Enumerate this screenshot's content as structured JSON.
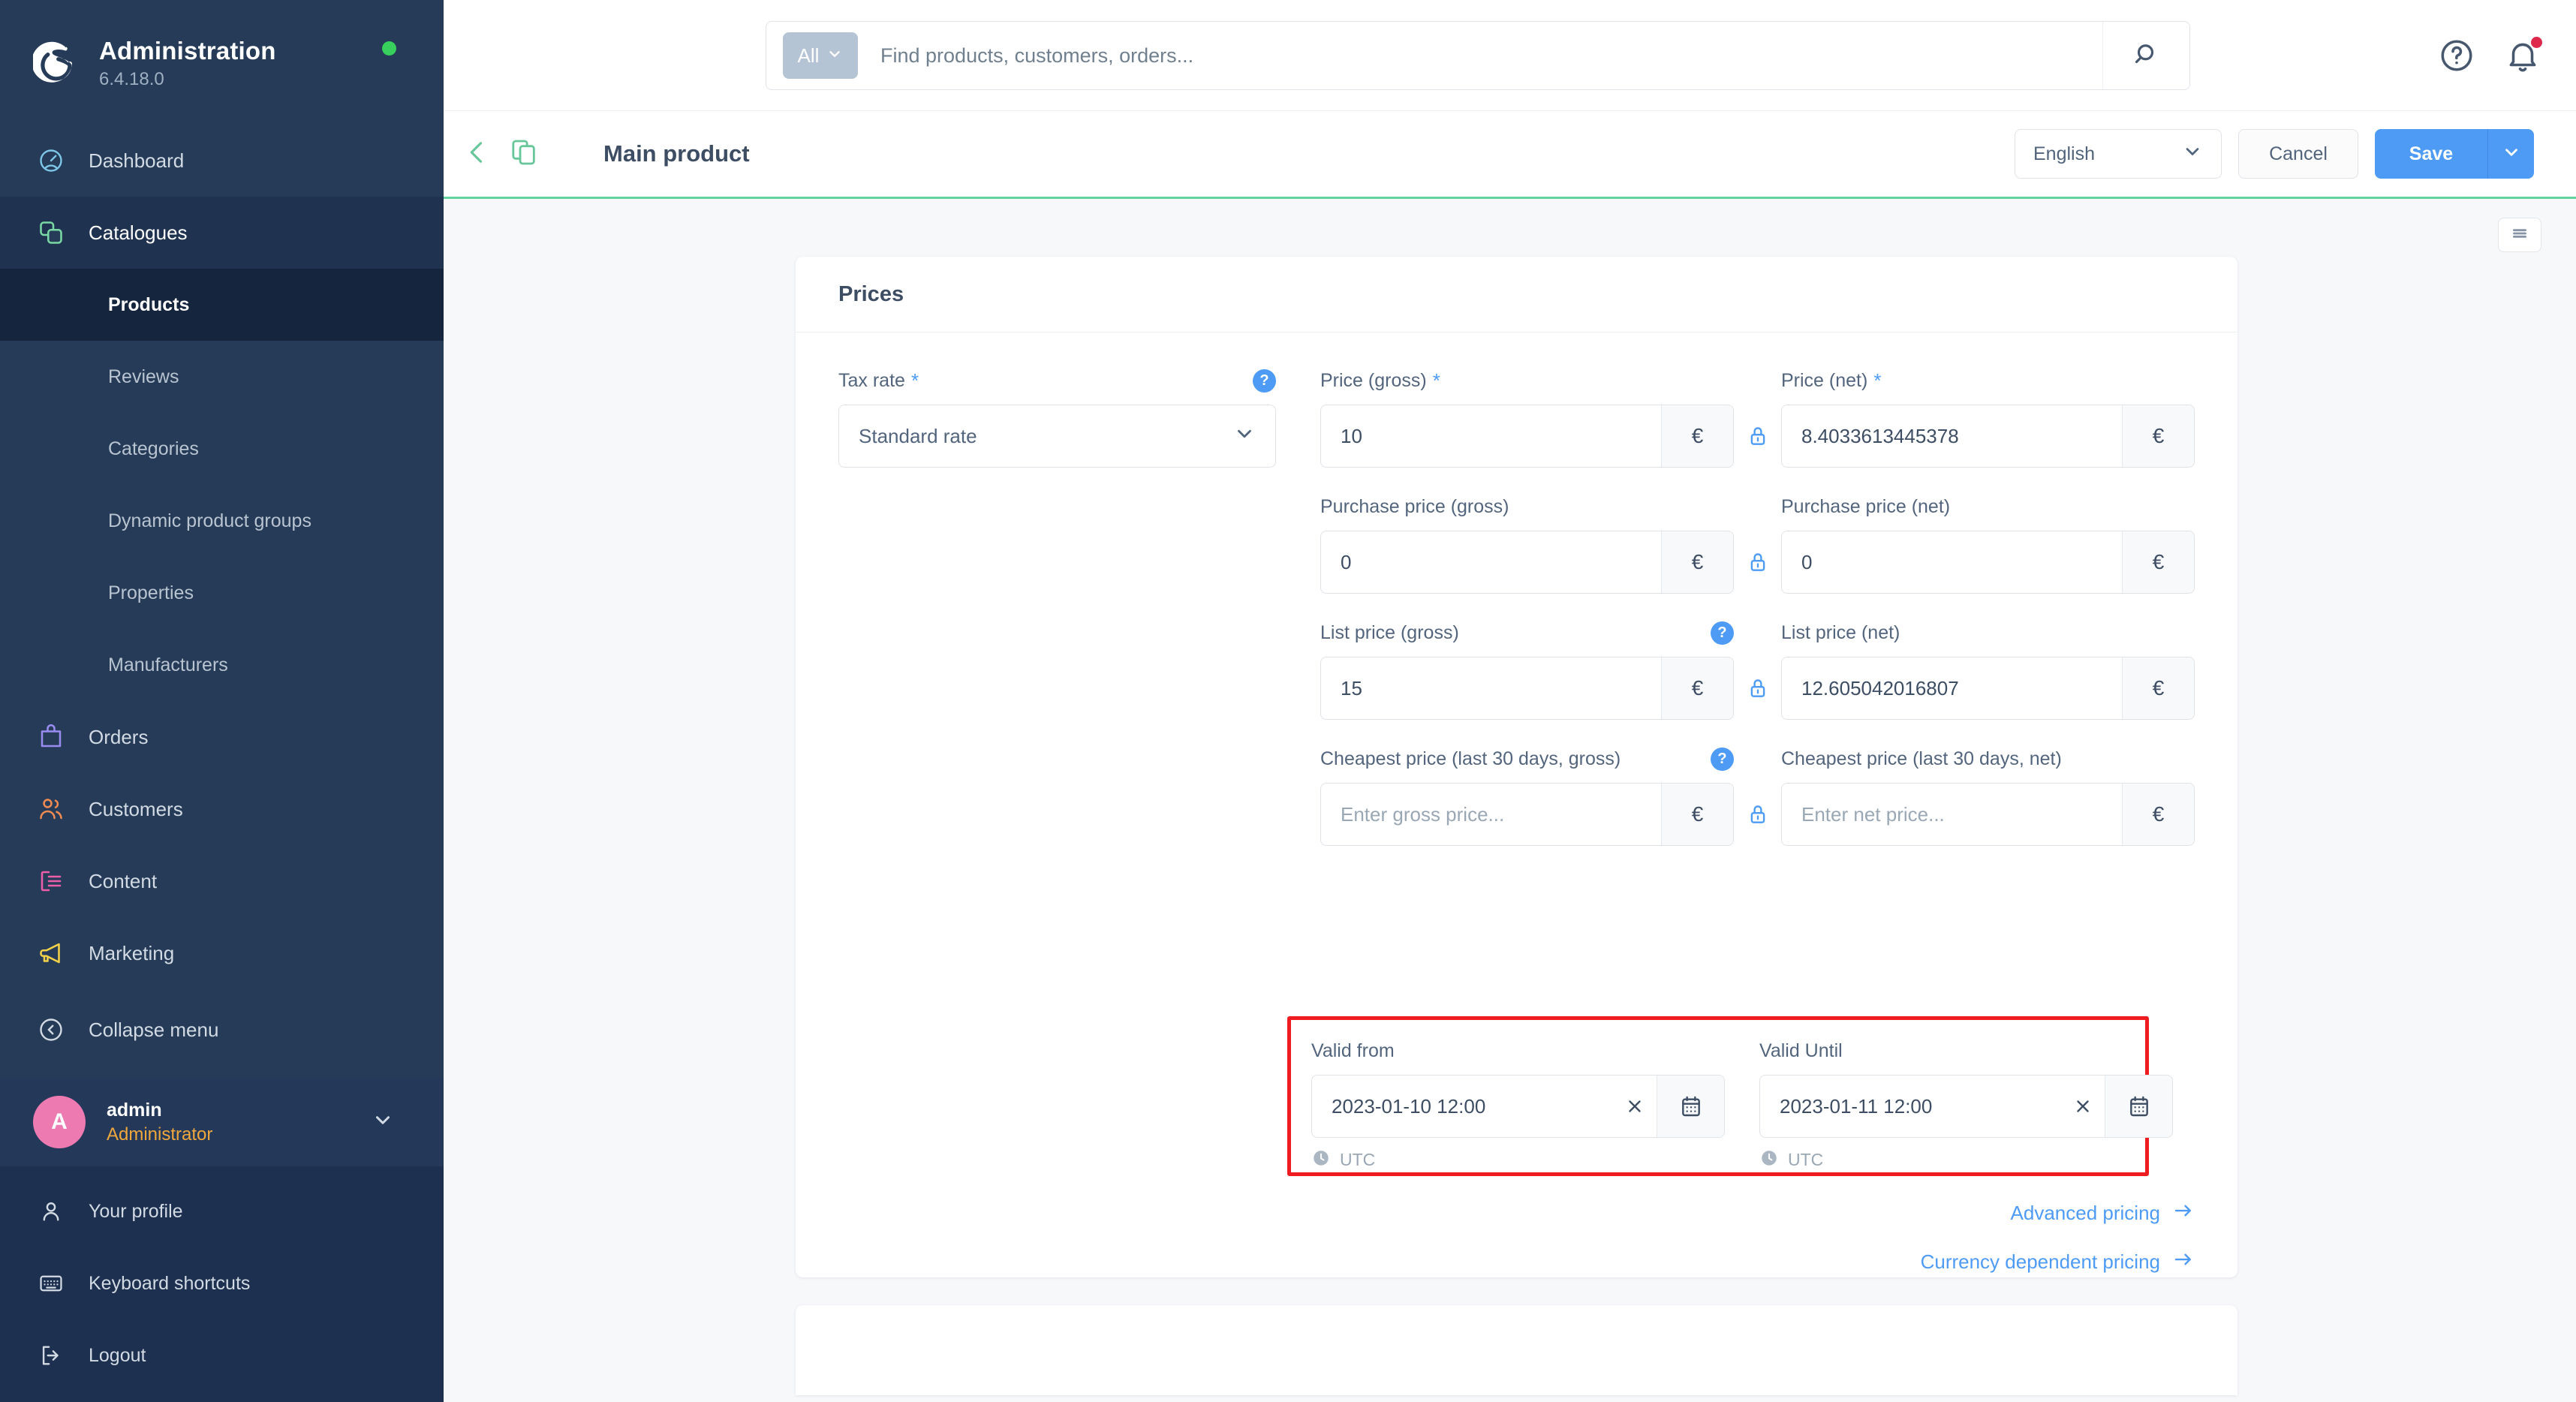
{
  "sidebar": {
    "brand_title": "Administration",
    "brand_version": "6.4.18.0",
    "status_color": "#37d05c",
    "nav": [
      {
        "label": "Dashboard",
        "icon": "speedometer-icon",
        "color": "#7ec6e8"
      },
      {
        "label": "Catalogues",
        "icon": "catalogues-icon",
        "color": "#79d8a4"
      }
    ],
    "sub_items": [
      {
        "label": "Products",
        "active": true
      },
      {
        "label": "Reviews",
        "active": false
      },
      {
        "label": "Categories",
        "active": false
      },
      {
        "label": "Dynamic product groups",
        "active": false
      },
      {
        "label": "Properties",
        "active": false
      },
      {
        "label": "Manufacturers",
        "active": false
      }
    ],
    "nav2": [
      {
        "label": "Orders",
        "icon": "bag-icon",
        "color": "#9a8bf0"
      },
      {
        "label": "Customers",
        "icon": "users-icon",
        "color": "#ef8a52"
      },
      {
        "label": "Content",
        "icon": "content-icon",
        "color": "#ec5fa8"
      },
      {
        "label": "Marketing",
        "icon": "megaphone-icon",
        "color": "#f3d148"
      },
      {
        "label": "Collapse menu",
        "icon": "collapse-icon",
        "color": "#d2dae3"
      }
    ],
    "user": {
      "avatar_initial": "A",
      "name": "admin",
      "role": "Administrator",
      "avatar_color": "#ed7ab0"
    },
    "footer": [
      {
        "label": "Your profile",
        "icon": "person-icon"
      },
      {
        "label": "Keyboard shortcuts",
        "icon": "keyboard-icon"
      },
      {
        "label": "Logout",
        "icon": "logout-icon"
      }
    ]
  },
  "topbar": {
    "scope_label": "All",
    "search_placeholder": "Find products, customers, orders...",
    "search_value": "",
    "help_icon": "question-circle-icon",
    "notifications_icon": "bell-icon",
    "notification_badge_color": "#de294c"
  },
  "pagehead": {
    "title": "Main product",
    "back_icon": "chevron-left-icon",
    "duplicate_icon": "copy-icon",
    "language": "English",
    "cancel_label": "Cancel",
    "save_label": "Save",
    "accent_color": "#62d39d",
    "primary_color": "#4e9bf5"
  },
  "content": {
    "list_toggle_icon": "list-icon",
    "card": {
      "title": "Prices",
      "tax": {
        "label": "Tax rate",
        "required": true,
        "help": "?",
        "value": "Standard rate"
      },
      "price_rows": [
        {
          "gross": {
            "label": "Price (gross)",
            "required": true,
            "help": null,
            "value": "10",
            "placeholder": "",
            "suffix": "€"
          },
          "net": {
            "label": "Price (net)",
            "required": true,
            "value": "8.4033613445378",
            "placeholder": "",
            "suffix": "€"
          },
          "lock_icon": "lock-icon"
        },
        {
          "gross": {
            "label": "Purchase price (gross)",
            "required": false,
            "help": null,
            "value": "0",
            "placeholder": "",
            "suffix": "€"
          },
          "net": {
            "label": "Purchase price (net)",
            "required": false,
            "value": "0",
            "placeholder": "",
            "suffix": "€"
          },
          "lock_icon": "lock-icon"
        },
        {
          "gross": {
            "label": "List price (gross)",
            "required": false,
            "help": "?",
            "value": "15",
            "placeholder": "",
            "suffix": "€"
          },
          "net": {
            "label": "List price (net)",
            "required": false,
            "value": "12.605042016807",
            "placeholder": "",
            "suffix": "€"
          },
          "lock_icon": "lock-icon"
        },
        {
          "gross": {
            "label": "Cheapest price (last 30 days, gross)",
            "required": false,
            "help": "?",
            "value": "",
            "placeholder": "Enter gross price...",
            "suffix": "€"
          },
          "net": {
            "label": "Cheapest price (last 30 days, net)",
            "required": false,
            "value": "",
            "placeholder": "Enter net price...",
            "suffix": "€"
          },
          "lock_icon": "lock-icon"
        }
      ],
      "valid": {
        "highlight_color": "#ee1c20",
        "from": {
          "label": "Valid from",
          "value": "2023-01-10 12:00",
          "clear_icon": "close-icon",
          "calendar_icon": "calendar-icon",
          "timezone": "UTC",
          "timezone_icon": "clock-icon"
        },
        "until": {
          "label": "Valid Until",
          "value": "2023-01-11 12:00",
          "clear_icon": "close-icon",
          "calendar_icon": "calendar-icon",
          "timezone": "UTC",
          "timezone_icon": "clock-icon"
        }
      },
      "links": [
        {
          "label": "Advanced pricing",
          "icon": "arrow-right-icon"
        },
        {
          "label": "Currency dependent pricing",
          "icon": "arrow-right-icon"
        }
      ]
    }
  }
}
